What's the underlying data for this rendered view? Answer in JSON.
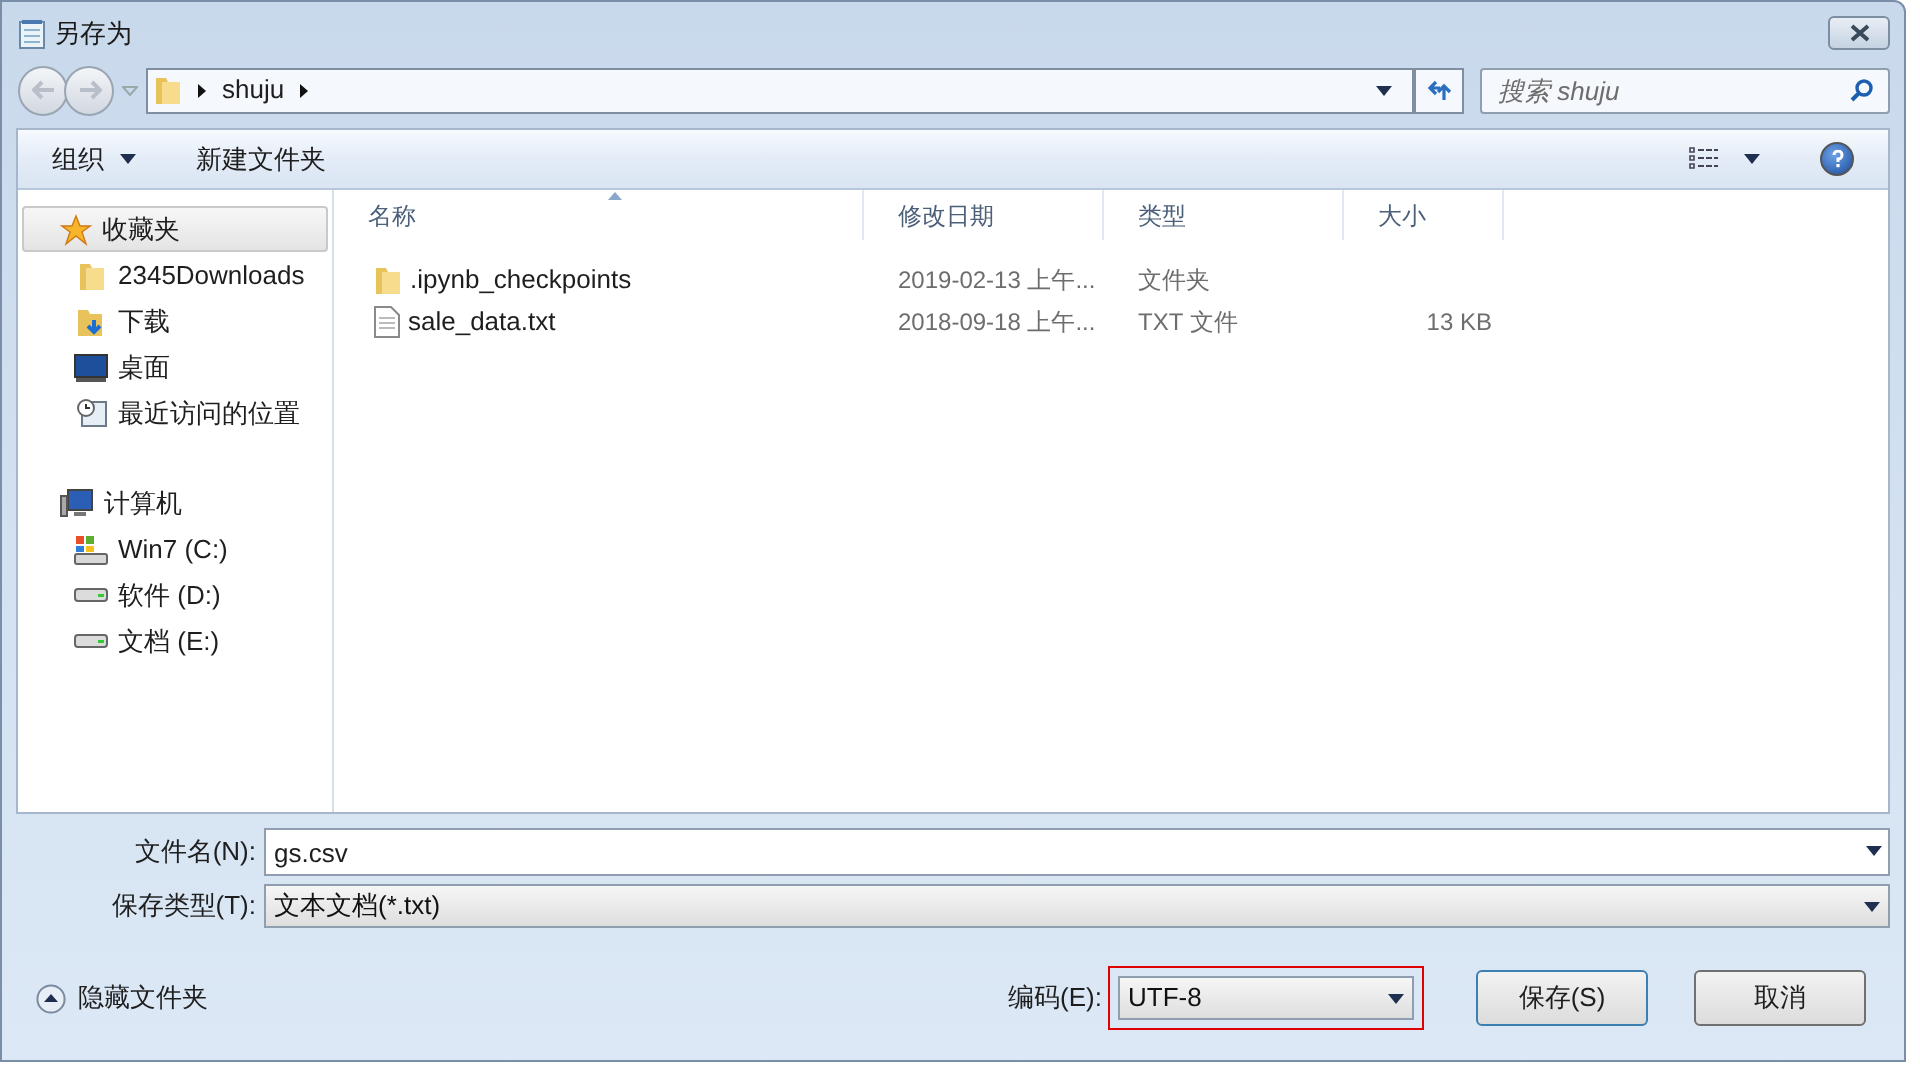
{
  "window": {
    "title": "另存为"
  },
  "address": {
    "path": [
      "shuju"
    ]
  },
  "search": {
    "placeholder": "搜索 shuju"
  },
  "toolbar": {
    "organize": "组织",
    "new_folder": "新建文件夹"
  },
  "sidebar": {
    "groups": [
      {
        "label": "收藏夹",
        "kind": "favorites",
        "selected": true,
        "children": [
          {
            "label": "2345Downloads",
            "kind": "folder"
          },
          {
            "label": "下载",
            "kind": "download"
          },
          {
            "label": "桌面",
            "kind": "desktop"
          },
          {
            "label": "最近访问的位置",
            "kind": "recent"
          }
        ]
      },
      {
        "label": "计算机",
        "kind": "computer",
        "selected": false,
        "children": [
          {
            "label": "Win7 (C:)",
            "kind": "system-drive"
          },
          {
            "label": "软件 (D:)",
            "kind": "drive"
          },
          {
            "label": "文档 (E:)",
            "kind": "drive"
          }
        ]
      }
    ]
  },
  "table": {
    "columns": [
      "名称",
      "修改日期",
      "类型",
      "大小"
    ],
    "rows": [
      {
        "kind": "folder",
        "name": ".ipynb_checkpoints",
        "date": "2019-02-13 上午...",
        "type": "文件夹",
        "size": ""
      },
      {
        "kind": "file",
        "name": "sale_data.txt",
        "date": "2018-09-18 上午...",
        "type": "TXT 文件",
        "size": "13 KB"
      }
    ]
  },
  "filename": {
    "label": "文件名(N):",
    "value": "gs.csv"
  },
  "filetype": {
    "label": "保存类型(T):",
    "value": "文本文档(*.txt)"
  },
  "hide_folders": "隐藏文件夹",
  "encoding": {
    "label": "编码(E):",
    "value": "UTF-8",
    "highlighted": true
  },
  "buttons": [
    "保存(S)",
    "取消"
  ]
}
